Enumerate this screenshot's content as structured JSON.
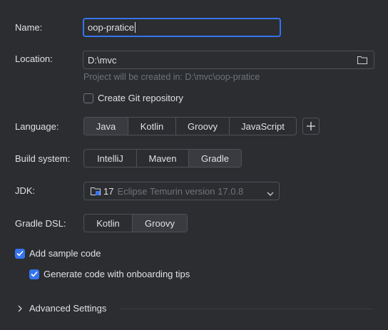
{
  "name": {
    "label": "Name:",
    "value": "oop-pratice"
  },
  "location": {
    "label": "Location:",
    "value": "D:\\mvc",
    "hint": "Project will be created in: D:\\mvc\\oop-pratice",
    "folder_icon": "folder-icon"
  },
  "git": {
    "label": "Create Git repository",
    "checked": false
  },
  "language": {
    "label": "Language:",
    "options": [
      "Java",
      "Kotlin",
      "Groovy",
      "JavaScript"
    ],
    "selected": "Java",
    "add_icon": "plus-icon"
  },
  "build_system": {
    "label": "Build system:",
    "options": [
      "IntelliJ",
      "Maven",
      "Gradle"
    ],
    "selected": "Gradle"
  },
  "jdk": {
    "label": "JDK:",
    "version": "17",
    "description": "Eclipse Temurin version 17.0.8"
  },
  "gradle_dsl": {
    "label": "Gradle DSL:",
    "options": [
      "Kotlin",
      "Groovy"
    ],
    "selected": "Groovy"
  },
  "sample_code": {
    "label": "Add sample code",
    "checked": true
  },
  "onboarding": {
    "label": "Generate code with onboarding tips",
    "checked": true
  },
  "advanced": {
    "label": "Advanced Settings"
  },
  "colors": {
    "accent": "#3574f0",
    "background": "#2b2d30",
    "selected_segment": "#393b40",
    "hint_text": "#6f737a"
  }
}
